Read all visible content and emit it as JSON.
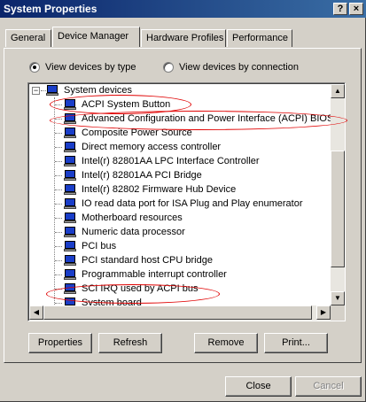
{
  "window": {
    "title": "System Properties",
    "help_label": "?",
    "close_label": "×"
  },
  "tabs": [
    {
      "label": "General"
    },
    {
      "label": "Device Manager"
    },
    {
      "label": "Hardware Profiles"
    },
    {
      "label": "Performance"
    }
  ],
  "view_options": {
    "by_type": {
      "label": "View devices by type",
      "selected": true
    },
    "by_connection": {
      "label": "View devices by connection",
      "selected": false
    }
  },
  "tree": {
    "root": "System devices",
    "items": [
      "ACPI System Button",
      "Advanced Configuration and Power Interface (ACPI) BIOS",
      "Composite Power Source",
      "Direct memory access controller",
      "Intel(r) 82801AA LPC Interface Controller",
      "Intel(r) 82801AA PCI Bridge",
      "Intel(r) 82802 Firmware Hub Device",
      "IO read data port for ISA Plug and Play enumerator",
      "Motherboard resources",
      "Numeric data processor",
      "PCI bus",
      "PCI standard host CPU bridge",
      "Programmable interrupt controller",
      "SCI IRQ used by ACPI bus",
      "System board"
    ],
    "highlighted": [
      "ACPI System Button",
      "Advanced Configuration and Power Interface (ACPI) BIOS",
      "SCI IRQ used by ACPI bus"
    ],
    "highlight_color": "#e00000"
  },
  "actions": {
    "properties": "Properties",
    "refresh": "Refresh",
    "remove": "Remove",
    "print": "Print..."
  },
  "footer": {
    "close": "Close",
    "cancel": "Cancel"
  },
  "colors": {
    "titlebar": "#0a246a",
    "face": "#d4d0c8",
    "device_icon": "#1a3ec8"
  }
}
